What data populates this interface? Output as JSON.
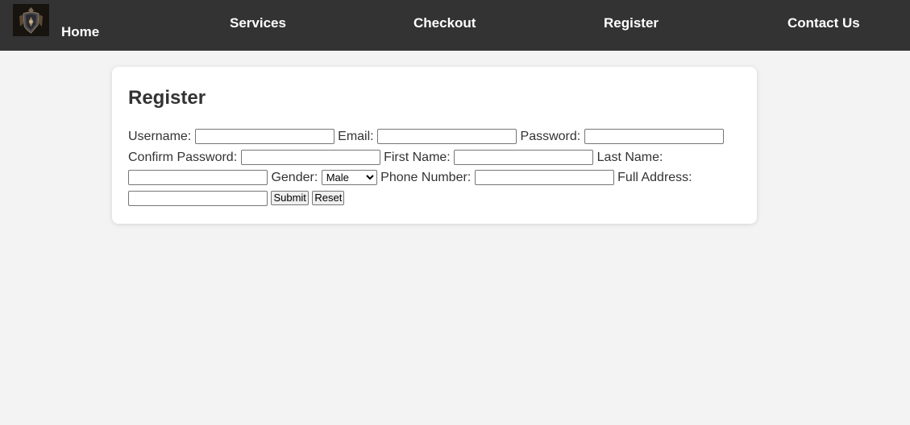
{
  "nav": {
    "home": "Home",
    "services": "Services",
    "checkout": "Checkout",
    "register": "Register",
    "contact": "Contact Us"
  },
  "form": {
    "title": "Register",
    "username_label": "Username:",
    "email_label": "Email:",
    "password_label": "Password:",
    "confirm_password_label": "Confirm Password:",
    "first_name_label": "First Name:",
    "last_name_label": "Last Name:",
    "gender_label": "Gender:",
    "gender_selected": "Male",
    "gender_options": [
      "Male"
    ],
    "phone_label": "Phone Number:",
    "address_label": "Full Address:",
    "submit_label": "Submit",
    "reset_label": "Reset"
  },
  "colors": {
    "navbar": "#333333",
    "page_background": "#f3f3f3",
    "card_background": "#ffffff",
    "text": "#333333"
  }
}
